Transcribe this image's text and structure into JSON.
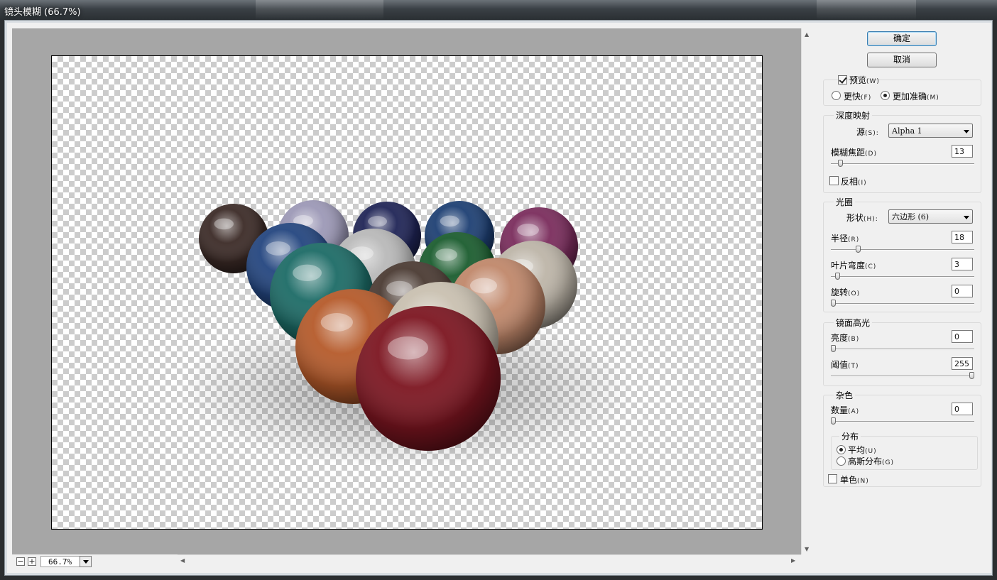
{
  "window": {
    "title": "镜头模糊 (66.7%)"
  },
  "buttons": {
    "ok": "确定",
    "cancel": "取消"
  },
  "preview_opts": {
    "preview": "预览",
    "preview_key": "(W)",
    "faster": "更快",
    "faster_key": "(F)",
    "accurate": "更加准确",
    "accurate_key": "(M)"
  },
  "depth_map": {
    "title": "深度映射",
    "source_label": "源",
    "source_key": "(S):",
    "source_value": "Alpha 1",
    "focal_label": "模糊焦距",
    "focal_key": "(D)",
    "focal_value": "13",
    "invert_label": "反相",
    "invert_key": "(I)"
  },
  "iris": {
    "title": "光圈",
    "shape_label": "形状",
    "shape_key": "(H):",
    "shape_value": "六边形 (6)",
    "radius_label": "半径",
    "radius_key": "(R)",
    "radius_value": "18",
    "curvature_label": "叶片弯度",
    "curvature_key": "(C)",
    "curvature_value": "3",
    "rotation_label": "旋转",
    "rotation_key": "(O)",
    "rotation_value": "0"
  },
  "specular": {
    "title": "镜面高光",
    "brightness_label": "亮度",
    "brightness_key": "(B)",
    "brightness_value": "0",
    "threshold_label": "阈值",
    "threshold_key": "(T)",
    "threshold_value": "255"
  },
  "noise": {
    "title": "杂色",
    "amount_label": "数量",
    "amount_key": "(A)",
    "amount_value": "0",
    "dist_title": "分布",
    "uniform_label": "平均",
    "uniform_key": "(U)",
    "gaussian_label": "高斯分布",
    "gaussian_key": "(G)",
    "mono_label": "单色",
    "mono_key": "(N)"
  },
  "zoom": {
    "value": "66.7%"
  },
  "sliders": {
    "focal": 0.05,
    "radius": 0.18,
    "curvature": 0.03,
    "rotation": 0.0,
    "brightness": 0.0,
    "threshold": 1.0,
    "amount": 0.0
  },
  "balls": [
    {
      "color": "#3b2a26"
    },
    {
      "color": "#9c98b6"
    },
    {
      "color": "#1f2456"
    },
    {
      "color": "#1d3f73"
    },
    {
      "color": "#7a2c5c"
    },
    {
      "color": "#23457f"
    },
    {
      "color": "#b9b9b9"
    },
    {
      "color": "#1a5c2e"
    },
    {
      "color": "#bdb5a8"
    },
    {
      "color": "#1c6b66"
    },
    {
      "color": "#4a3a32"
    },
    {
      "color": "#c0876a"
    },
    {
      "color": "#b55a2a"
    },
    {
      "color": "#c9c0b0"
    },
    {
      "color": "#7c1520"
    }
  ]
}
